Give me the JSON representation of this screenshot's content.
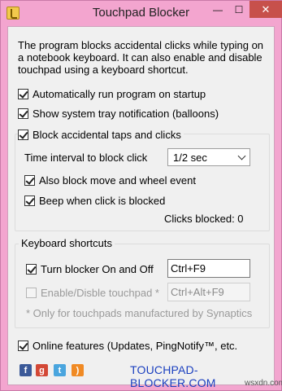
{
  "window": {
    "title": "Touchpad Blocker",
    "close_glyph": "✕",
    "min_glyph": "—",
    "max_glyph": "☐",
    "icon": "hand-icon"
  },
  "description": "The program blocks accidental clicks while typing on a notebook keyboard. It can also enable and disable touchpad using a keyboard shortcut.",
  "options": {
    "auto_run": {
      "label": "Automatically run program on startup",
      "checked": true
    },
    "tray_notification": {
      "label": "Show system tray notification (balloons)",
      "checked": true
    },
    "block_taps": {
      "label": "Block accidental taps and clicks",
      "checked": true
    },
    "time_interval_label": "Time interval to block click",
    "time_interval_value": "1/2 sec",
    "block_move_wheel": {
      "label": "Also block move and wheel event",
      "checked": true
    },
    "beep": {
      "label": "Beep when click is blocked",
      "checked": true
    },
    "clicks_blocked": "Clicks blocked: 0"
  },
  "shortcuts": {
    "group_label": "Keyboard shortcuts",
    "turn_blocker": {
      "label": "Turn blocker On and Off",
      "checked": true,
      "value": "Ctrl+F9"
    },
    "enable_touchpad": {
      "label": "Enable/Disble touchpad *",
      "checked": false,
      "value": "Ctrl+Alt+F9"
    },
    "note": "* Only for touchpads manufactured by Synaptics"
  },
  "online": {
    "label": "Online features (Updates, PingNotify™, etc.",
    "checked": true
  },
  "footer": {
    "link": "TOUCHPAD-BLOCKER.COM",
    "social": [
      "facebook-icon",
      "google-plus-icon",
      "twitter-icon",
      "rss-icon"
    ],
    "watermark": "wsxdn.com"
  },
  "colors": {
    "frame": "#f3a5cf",
    "close_button": "#c7504b",
    "link": "#1a3fbf"
  }
}
